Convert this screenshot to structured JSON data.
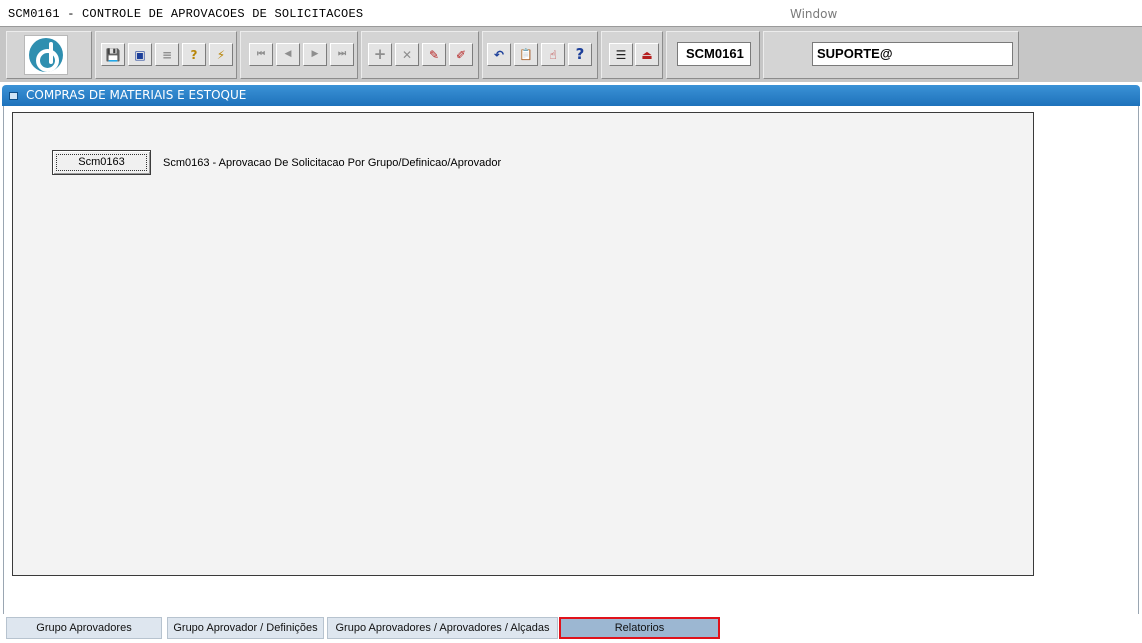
{
  "window": {
    "title": "SCM0161 - CONTROLE DE APROVACOES DE SOLICITACOES",
    "menu_window": "Window"
  },
  "toolbar": {
    "form_code": "SCM0161",
    "user": "SUPORTE@",
    "buttons": [
      {
        "name": "save-icon",
        "glyph": "💾"
      },
      {
        "name": "clear-icon",
        "glyph": "▣"
      },
      {
        "name": "print-icon",
        "glyph": "≡"
      },
      {
        "name": "query-icon",
        "glyph": "?"
      },
      {
        "name": "execute-query-icon",
        "glyph": "⚡"
      },
      {
        "name": "first-record-icon",
        "glyph": "⏮"
      },
      {
        "name": "previous-record-icon",
        "glyph": "◀"
      },
      {
        "name": "next-record-icon",
        "glyph": "▶"
      },
      {
        "name": "last-record-icon",
        "glyph": "⏭"
      },
      {
        "name": "insert-record-icon",
        "glyph": "+"
      },
      {
        "name": "delete-record-icon",
        "glyph": "✕"
      },
      {
        "name": "lock-record-icon",
        "glyph": "✎"
      },
      {
        "name": "edit-icon",
        "glyph": "✐"
      },
      {
        "name": "undo-icon",
        "glyph": "↶"
      },
      {
        "name": "clipboard-icon",
        "glyph": "📋"
      },
      {
        "name": "list-values-icon",
        "glyph": "☝"
      },
      {
        "name": "help-icon",
        "glyph": "?"
      },
      {
        "name": "menu-icon",
        "glyph": "☰"
      },
      {
        "name": "exit-icon",
        "glyph": "⏏"
      }
    ]
  },
  "section": {
    "title": "COMPRAS DE MATERIAIS E ESTOQUE"
  },
  "reports": [
    {
      "button_label": "Scm0163",
      "description": "Scm0163 - Aprovacao De Solicitacao Por Grupo/Definicao/Aprovador"
    }
  ],
  "tabs": [
    {
      "label": "Grupo Aprovadores"
    },
    {
      "label": "Grupo Aprovador / Definições"
    },
    {
      "label": "Grupo Aprovadores / Aprovadores / Alçadas"
    },
    {
      "label": "Relatorios",
      "active": true
    }
  ]
}
